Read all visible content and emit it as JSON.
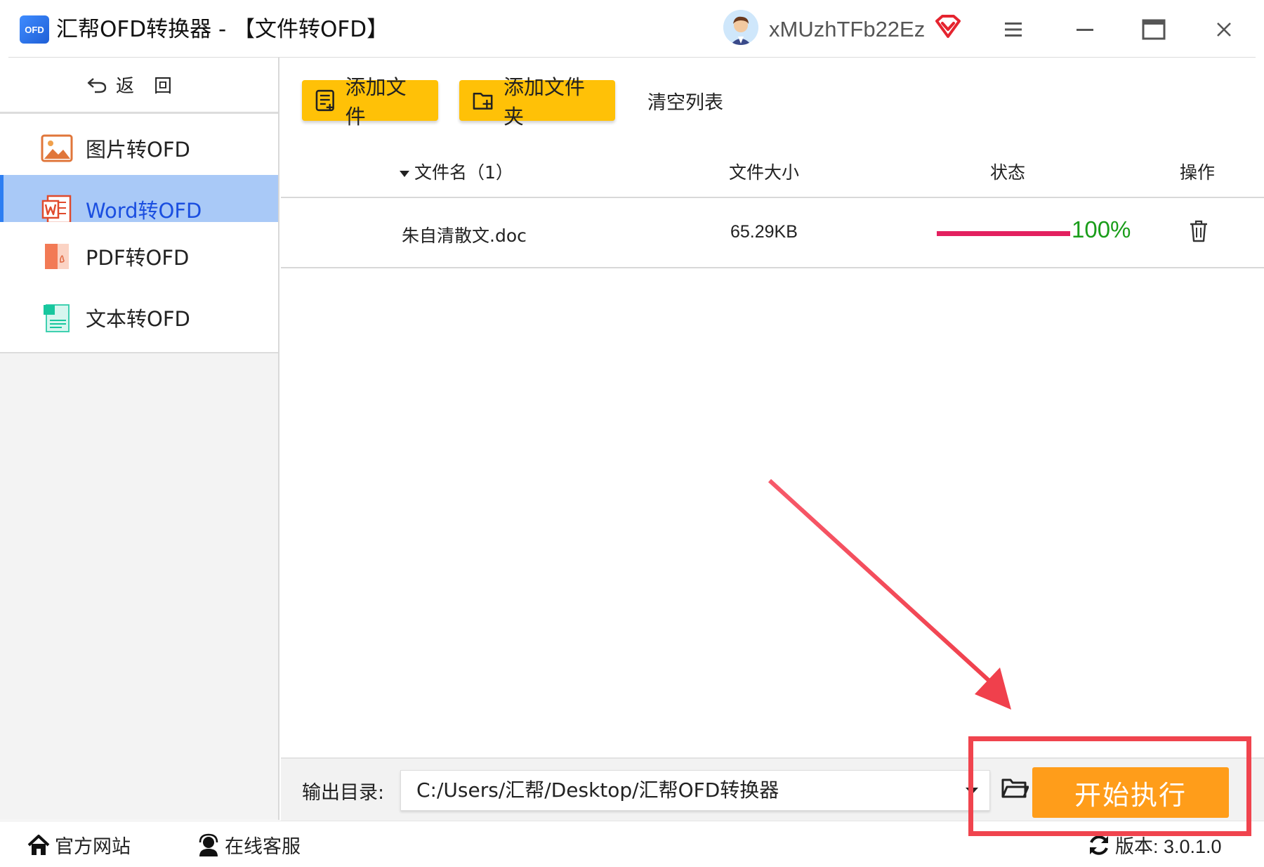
{
  "window": {
    "logo_text": "OFD",
    "title": "汇帮OFD转换器 - 【文件转OFD】",
    "username": "xMUzhTFb22Ez"
  },
  "sidebar": {
    "back_label": "返回",
    "items": [
      {
        "label": "图片转OFD",
        "icon": "image-icon",
        "active": false
      },
      {
        "label": "Word转OFD",
        "icon": "word-icon",
        "active": true
      },
      {
        "label": "PDF转OFD",
        "icon": "pdf-icon",
        "active": false
      },
      {
        "label": "文本转OFD",
        "icon": "text-file-icon",
        "active": false
      }
    ]
  },
  "toolbar": {
    "add_file": "添加文件",
    "add_folder": "添加文件夹",
    "clear_list": "清空列表"
  },
  "table": {
    "headers": {
      "filename": "文件名（1）",
      "size": "文件大小",
      "status": "状态",
      "action": "操作"
    },
    "rows": [
      {
        "filename": "朱自清散文.doc",
        "size": "65.29KB",
        "progress_percent": 100,
        "progress_text": "100%"
      }
    ]
  },
  "output": {
    "label": "输出目录:",
    "path": "C:/Users/汇帮/Desktop/汇帮OFD转换器",
    "start_label": "开始执行"
  },
  "statusbar": {
    "website": "官方网站",
    "support": "在线客服",
    "version": "版本: 3.0.1.0"
  },
  "colors": {
    "accent_yellow": "#ffc107",
    "start_orange": "#ff9d1a",
    "active_nav_bg": "#a9c9f7",
    "active_nav_text": "#1a4ee0",
    "progress_bar": "#e3205f",
    "progress_text": "#1a9d1a",
    "annotation_red": "#f0444e"
  }
}
